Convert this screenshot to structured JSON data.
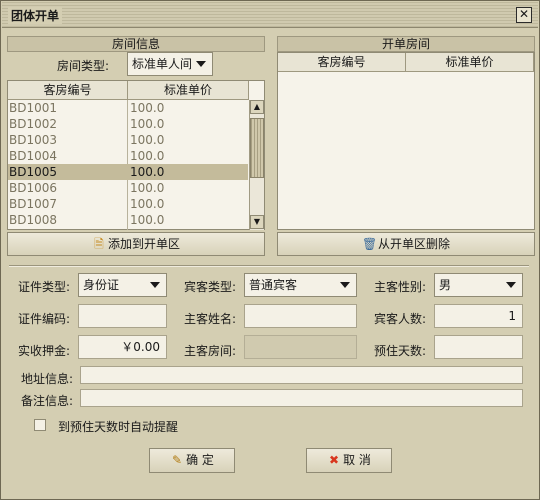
{
  "window": {
    "title": "团体开单",
    "close_glyph": "✕"
  },
  "left_panel": {
    "header": "房间信息",
    "room_type_label": "房间类型:",
    "room_type_value": "标准单人间",
    "columns": [
      "客房编号",
      "标准单价"
    ],
    "rows": [
      {
        "id": "BD1001",
        "price": "100.0"
      },
      {
        "id": "BD1002",
        "price": "100.0"
      },
      {
        "id": "BD1003",
        "price": "100.0"
      },
      {
        "id": "BD1004",
        "price": "100.0"
      },
      {
        "id": "BD1005",
        "price": "100.0"
      },
      {
        "id": "BD1006",
        "price": "100.0"
      },
      {
        "id": "BD1007",
        "price": "100.0"
      },
      {
        "id": "BD1008",
        "price": "100.0"
      }
    ],
    "selected_row": 4,
    "add_button": "添加到开单区"
  },
  "right_panel": {
    "header": "开单房间",
    "columns": [
      "客房编号",
      "标准单价"
    ],
    "remove_button": "从开单区删除"
  },
  "form": {
    "id_type_label": "证件类型:",
    "id_type_value": "身份证",
    "guest_type_label": "宾客类型:",
    "guest_type_value": "普通宾客",
    "gender_label": "主客性别:",
    "gender_value": "男",
    "id_number_label": "证件编码:",
    "id_number_value": "",
    "guest_name_label": "主客姓名:",
    "guest_name_value": "",
    "guest_count_label": "宾客人数:",
    "guest_count_value": "1",
    "deposit_label": "实收押金:",
    "deposit_value": "￥0.00",
    "main_room_label": "主客房间:",
    "main_room_value": "",
    "stay_days_label": "预住天数:",
    "stay_days_value": "",
    "address_label": "地址信息:",
    "address_value": "",
    "remark_label": "备注信息:",
    "remark_value": "",
    "reminder_label": "到预住天数时自动提醒",
    "reminder_checked": false
  },
  "actions": {
    "ok": "确 定",
    "cancel": "取 消"
  },
  "colors": {
    "window_bg": "#d4ceb2",
    "selected_row": "#c4bb9b",
    "cancel_icon": "#d8361e"
  }
}
